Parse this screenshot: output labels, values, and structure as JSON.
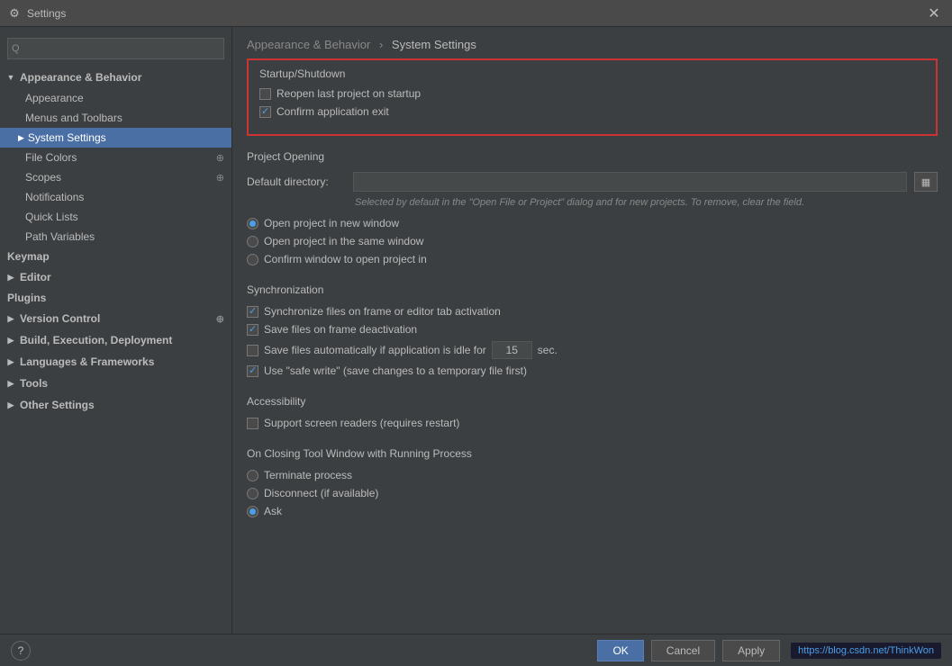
{
  "window": {
    "title": "Settings",
    "icon": "⚙"
  },
  "search": {
    "placeholder": "Q-"
  },
  "sidebar": {
    "appearance_behavior": {
      "label": "Appearance & Behavior",
      "expanded": true,
      "items": [
        {
          "id": "appearance",
          "label": "Appearance"
        },
        {
          "id": "menus-toolbars",
          "label": "Menus and Toolbars"
        },
        {
          "id": "system-settings",
          "label": "System Settings",
          "active": true
        },
        {
          "id": "file-colors",
          "label": "File Colors",
          "has_icon": true
        },
        {
          "id": "scopes",
          "label": "Scopes",
          "has_icon": true
        },
        {
          "id": "notifications",
          "label": "Notifications"
        },
        {
          "id": "quick-lists",
          "label": "Quick Lists"
        },
        {
          "id": "path-variables",
          "label": "Path Variables"
        }
      ]
    },
    "keymap": {
      "label": "Keymap"
    },
    "editor": {
      "label": "Editor",
      "collapsed": true
    },
    "plugins": {
      "label": "Plugins"
    },
    "version_control": {
      "label": "Version Control",
      "collapsed": true,
      "has_icon": true
    },
    "build_execution": {
      "label": "Build, Execution, Deployment",
      "collapsed": true
    },
    "languages_frameworks": {
      "label": "Languages & Frameworks",
      "collapsed": true
    },
    "tools": {
      "label": "Tools",
      "collapsed": true
    },
    "other_settings": {
      "label": "Other Settings",
      "collapsed": true
    }
  },
  "breadcrumb": {
    "parent": "Appearance & Behavior",
    "separator": "›",
    "current": "System Settings"
  },
  "sections": {
    "startup_shutdown": {
      "title": "Startup/Shutdown",
      "highlighted": true,
      "reopen_last_project": {
        "label": "Reopen last project on startup",
        "checked": false
      },
      "confirm_exit": {
        "label": "Confirm application exit",
        "checked": true
      }
    },
    "project_opening": {
      "title": "Project Opening",
      "default_directory": {
        "label": "Default directory:",
        "value": "",
        "placeholder": ""
      },
      "hint": "Selected by default in the \"Open File or Project\" dialog and for new projects. To remove, clear the field.",
      "open_options": [
        {
          "id": "new-window",
          "label": "Open project in new window",
          "checked": true
        },
        {
          "id": "same-window",
          "label": "Open project in the same window",
          "checked": false
        },
        {
          "id": "confirm-window",
          "label": "Confirm window to open project in",
          "checked": false
        }
      ]
    },
    "synchronization": {
      "title": "Synchronization",
      "sync_files": {
        "label": "Synchronize files on frame or editor tab activation",
        "checked": true
      },
      "save_on_deactivation": {
        "label": "Save files on frame deactivation",
        "checked": true
      },
      "save_automatically": {
        "label": "Save files automatically if application is idle for",
        "checked": false,
        "seconds_value": "15",
        "seconds_label": "sec."
      },
      "safe_write": {
        "label": "Use \"safe write\" (save changes to a temporary file first)",
        "checked": true
      }
    },
    "accessibility": {
      "title": "Accessibility",
      "screen_readers": {
        "label": "Support screen readers (requires restart)",
        "checked": false
      }
    },
    "closing_tool_window": {
      "title": "On Closing Tool Window with Running Process",
      "options": [
        {
          "id": "terminate",
          "label": "Terminate process",
          "checked": false
        },
        {
          "id": "disconnect",
          "label": "Disconnect (if available)",
          "checked": false
        },
        {
          "id": "ask",
          "label": "Ask",
          "checked": true
        }
      ]
    }
  },
  "bottom": {
    "help_label": "?",
    "ok_label": "OK",
    "cancel_label": "Cancel",
    "apply_label": "Apply"
  },
  "url_bar": "https://blog.csdn.net/ThinkWon"
}
